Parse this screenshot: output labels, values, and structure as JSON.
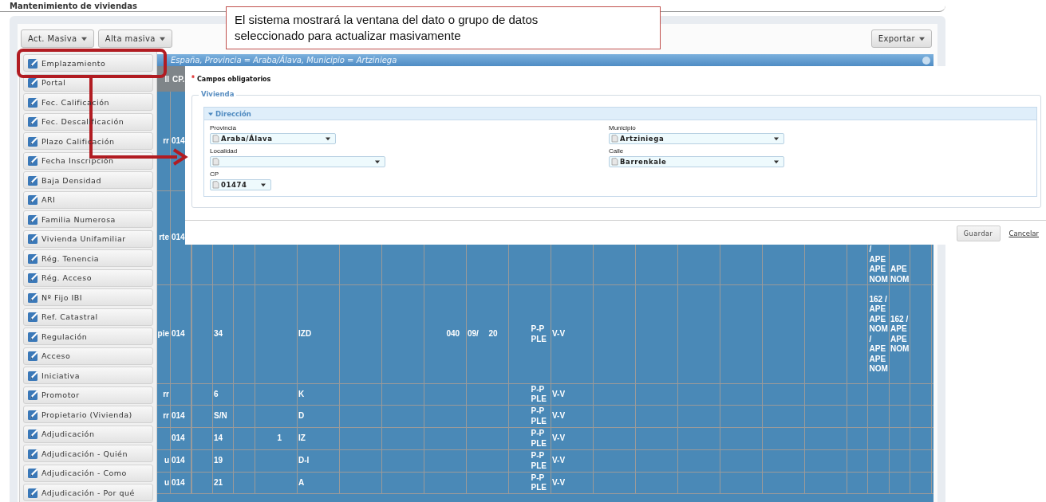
{
  "page": {
    "title": "Mantenimiento de viviendas"
  },
  "callout": {
    "text": "El sistema mostrará la ventana del dato o grupo de datos seleccionado para actualizar masivamente"
  },
  "toolbar": {
    "buttons": [
      {
        "label": "Act. Masiva"
      },
      {
        "label": "Alta masiva"
      }
    ],
    "export_button": {
      "label": "Exportar"
    }
  },
  "bulk_menu": {
    "items": [
      {
        "label": "Emplazamiento",
        "highlighted": true
      },
      {
        "label": "Portal",
        "highlighted": false
      },
      {
        "label": "Fec. Calificación",
        "highlighted": false
      },
      {
        "label": "Fec. Descalificación",
        "highlighted": false
      },
      {
        "label": "Plazo Calificación",
        "highlighted": false
      },
      {
        "label": "Fecha Inscripción",
        "highlighted": false
      },
      {
        "label": "Baja Densidad",
        "highlighted": false
      },
      {
        "label": "ARI",
        "highlighted": false
      },
      {
        "label": "Familia Numerosa",
        "highlighted": false
      },
      {
        "label": "Vivienda Unifamiliar",
        "highlighted": false
      },
      {
        "label": "Rég. Tenencia",
        "highlighted": false
      },
      {
        "label": "Rég. Acceso",
        "highlighted": false
      },
      {
        "label": "Nº Fijo IBI",
        "highlighted": false
      },
      {
        "label": "Ref. Catastral",
        "highlighted": false
      },
      {
        "label": "Regulación",
        "highlighted": false
      },
      {
        "label": "Acceso",
        "highlighted": false
      },
      {
        "label": "Iniciativa",
        "highlighted": false
      },
      {
        "label": "Promotor",
        "highlighted": false
      },
      {
        "label": "Propietario (Vivienda)",
        "highlighted": false
      },
      {
        "label": "Adjudicación",
        "highlighted": false
      },
      {
        "label": "Adjudicación - Quién",
        "highlighted": false
      },
      {
        "label": "Adjudicación - Como",
        "highlighted": false
      },
      {
        "label": "Adjudicación - Por qué",
        "highlighted": false
      }
    ]
  },
  "filter_bar": {
    "text": "España, Provincia = Araba/Álava, Municipio = Artziniega"
  },
  "table": {
    "columns": [
      "ll",
      "CP."
    ],
    "rows": [
      {
        "cells": {
          "column_1": "rr",
          "column_2": "014"
        }
      },
      {
        "cells": {
          "column_1": "rte",
          "column_2": "014",
          "column_35": "/ APE APE NOM",
          "column_36": "APE NOM"
        }
      },
      {
        "cells": {
          "column_1": "pie",
          "column_2": "014",
          "column_4": "34",
          "column_8": "IZD",
          "column_15": "040",
          "column_16": "09/",
          "column_17": "20",
          "column_19": "P-P PLE",
          "column_20": "V-V",
          "column_35": "162 / APE APE NOM / APE APE NOM",
          "column_36": "162 / APE APE NOM"
        }
      },
      {
        "cells": {
          "column_1": "rr",
          "column_4": "6",
          "column_8": "K",
          "column_19": "P-P PLE",
          "column_20": "V-V"
        }
      },
      {
        "cells": {
          "column_1": "rr",
          "column_2": "014",
          "column_4": "S/N",
          "column_8": "D",
          "column_19": "P-P PLE",
          "column_20": "V-V"
        }
      },
      {
        "cells": {
          "column_2": "014",
          "column_4": "14",
          "column_7": "1",
          "column_8": "IZ",
          "column_19": "P-P PLE",
          "column_20": "V-V"
        }
      },
      {
        "cells": {
          "column_1": "u",
          "column_2": "014",
          "column_4": "19",
          "column_8": "D-I",
          "column_19": "P-P PLE",
          "column_20": "V-V"
        }
      },
      {
        "cells": {
          "column_1": "u",
          "column_2": "014",
          "column_4": "21",
          "column_8": "A",
          "column_19": "P-P PLE",
          "column_20": "V-V"
        }
      }
    ]
  },
  "dialog": {
    "required_mark": "*",
    "required_note": "Campos obligatorios",
    "fieldset": {
      "legend": "Vivienda",
      "section": {
        "title": "Dirección",
        "expanded": true,
        "fields": [
          {
            "label": "Provincia",
            "value": "Araba/Álava"
          },
          {
            "label": "Municipio",
            "value": "Artziniega"
          },
          {
            "label": "Localidad"
          },
          {
            "label": "Calle",
            "value": "Barrenkale"
          },
          {
            "label": "CP",
            "value": "01474"
          }
        ]
      }
    },
    "save_button": "Guardar",
    "cancel_link": "Cancelar"
  }
}
